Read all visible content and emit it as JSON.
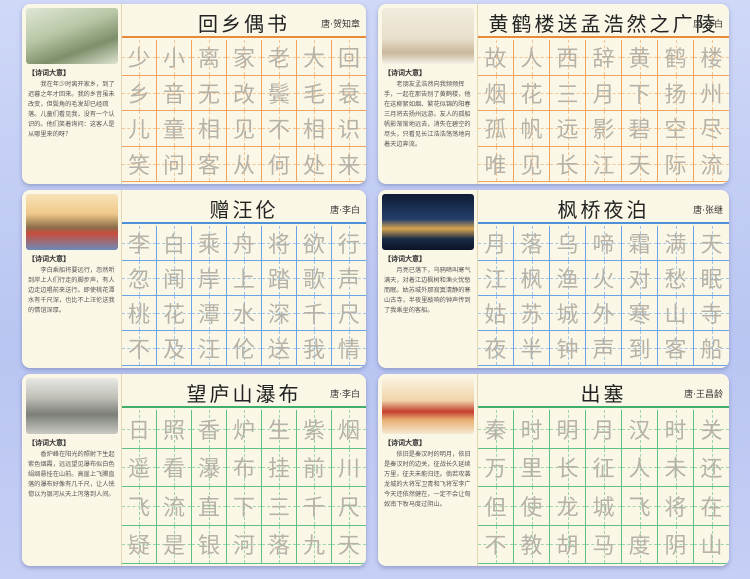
{
  "meaning_label": "【诗词大意】",
  "cards": [
    {
      "title": "回乡偶书",
      "author": "唐·贺知章",
      "theme": "orange",
      "meaning": "我在年少时离开家乡，到了迟暮之年才回来。我的乡音虽未改变，但鬓角的毛发却已经疏落。儿童们看见我，没有一个认识的。他们笑着询问：这客人是从哪里来的呀？",
      "lines": [
        "少小离家老大回",
        "乡音无改鬓毛衰",
        "儿童相见不相识",
        "笑问客从何处来"
      ]
    },
    {
      "title": "黄鹤楼送孟浩然之广陵",
      "author": "唐·李白",
      "theme": "orange",
      "meaning": "老朋友孟浩然向我频频挥手，一起在那告别了黄鹤楼，他在这柳絮如烟、繁花似锦的阳春三月将去扬州远游。友人的孤船帆影渐渐地远去，消失在碧空的尽头，只看见长江浩浩荡荡地向着天边奔流。",
      "lines": [
        "故人西辞黄鹤楼",
        "烟花三月下扬州",
        "孤帆远影碧空尽",
        "唯见长江天际流"
      ]
    },
    {
      "title": "赠汪伦",
      "author": "唐·李白",
      "theme": "blue",
      "meaning": "李白乘船将要远行，忽然听到岸上人们行走的脚步声，有人边走边唱前来送行。即使桃花潭水有千尺深，也比不上汪伦送我的情谊深厚。",
      "lines": [
        "李白乘舟将欲行",
        "忽闻岸上踏歌声",
        "桃花潭水深千尺",
        "不及汪伦送我情"
      ]
    },
    {
      "title": "枫桥夜泊",
      "author": "唐·张继",
      "theme": "blue",
      "meaning": "月亮已落下，乌鸦啼叫寒气满天，对着江边枫树和渔火忧愁而眠。姑苏城外那寂寞清静的寒山古寺，半夜里敲响的钟声传到了我乘坐的客船。",
      "lines": [
        "月落乌啼霜满天",
        "江枫渔火对愁眠",
        "姑苏城外寒山寺",
        "夜半钟声到客船"
      ]
    },
    {
      "title": "望庐山瀑布",
      "author": "唐·李白",
      "theme": "green",
      "meaning": "香炉峰在阳光的照射下生起紫色烟霞，远远望见瀑布似白色绢绸悬挂在山前。高崖上飞腾直落的瀑布好像有几千尺，让人恍惚以为银河从天上泻落到人间。",
      "lines": [
        "日照香炉生紫烟",
        "遥看瀑布挂前川",
        "飞流直下三千尺",
        "疑是银河落九天"
      ]
    },
    {
      "title": "出塞",
      "author": "唐·王昌龄",
      "theme": "green",
      "meaning": "依旧是秦汉时的明月，依旧是秦汉时的边关，征战长久延续万里，征夫未能归还。倘若攻袭龙城的大将军卫青和飞将军李广今天还依然健在，一定不会让匈奴南下牧马度过阴山。",
      "lines": [
        "秦时明月汉时关",
        "万里长征人未还",
        "但使龙城飞将在",
        "不教胡马度阴山"
      ]
    }
  ]
}
